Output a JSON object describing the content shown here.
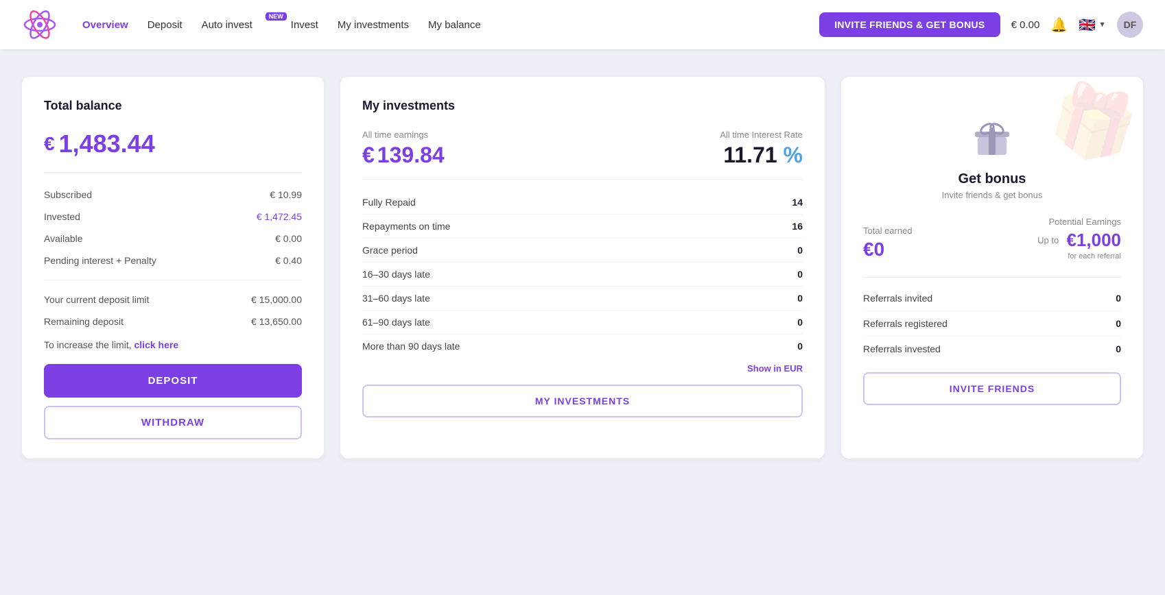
{
  "nav": {
    "links": [
      {
        "label": "Overview",
        "active": true
      },
      {
        "label": "Deposit",
        "active": false
      },
      {
        "label": "Auto invest",
        "active": false,
        "badge": "NEW"
      },
      {
        "label": "Invest",
        "active": false
      },
      {
        "label": "My investments",
        "active": false
      },
      {
        "label": "My balance",
        "active": false
      }
    ],
    "invite_btn": "INVITE FRIENDS & GET BONUS",
    "balance": "€ 0.00",
    "user_initials": "DF"
  },
  "total_balance": {
    "title": "Total balance",
    "amount": "1,483.44",
    "currency": "€",
    "rows": [
      {
        "label": "Subscribed",
        "value": "€ 10.99",
        "purple": false
      },
      {
        "label": "Invested",
        "value": "€ 1,472.45",
        "purple": true
      },
      {
        "label": "Available",
        "value": "€ 0.00",
        "purple": false
      },
      {
        "label": "Pending interest + Penalty",
        "value": "€ 0.40",
        "purple": false
      }
    ],
    "limit_rows": [
      {
        "label": "Your current deposit limit",
        "value": "€ 15,000.00"
      },
      {
        "label": "Remaining deposit",
        "value": "€ 13,650.00"
      }
    ],
    "increase_limit_text": "To increase the limit,",
    "increase_limit_link": "click here",
    "deposit_btn": "DEPOSIT",
    "withdraw_btn": "WITHDRAW"
  },
  "my_investments": {
    "title": "My investments",
    "all_time_earnings_label": "All time earnings",
    "all_time_rate_label": "All time Interest Rate",
    "earnings_amount": "139.84",
    "earnings_currency": "€",
    "interest_rate": "11.71",
    "percent_sign": "%",
    "rows": [
      {
        "label": "Fully Repaid",
        "value": "14"
      },
      {
        "label": "Repayments on time",
        "value": "16"
      },
      {
        "label": "Grace period",
        "value": "0"
      },
      {
        "label": "16–30 days late",
        "value": "0"
      },
      {
        "label": "31–60 days late",
        "value": "0"
      },
      {
        "label": "61–90 days late",
        "value": "0"
      },
      {
        "label": "More than 90 days late",
        "value": "0"
      }
    ],
    "show_in_eur": "Show in EUR",
    "my_inv_btn": "MY INVESTMENTS"
  },
  "referral": {
    "title_get_bonus": "Get bonus",
    "subtitle": "Invite friends & get bonus",
    "total_earned_label": "Total earned",
    "total_earned": "€0",
    "potential_label": "Potential Earnings",
    "upto": "Up to",
    "potential_amount": "€1,000",
    "for_each": "for each referral",
    "rows": [
      {
        "label": "Referrals invited",
        "value": "0"
      },
      {
        "label": "Referrals registered",
        "value": "0"
      },
      {
        "label": "Referrals invested",
        "value": "0"
      }
    ],
    "invite_btn": "INVITE FRIENDS"
  }
}
